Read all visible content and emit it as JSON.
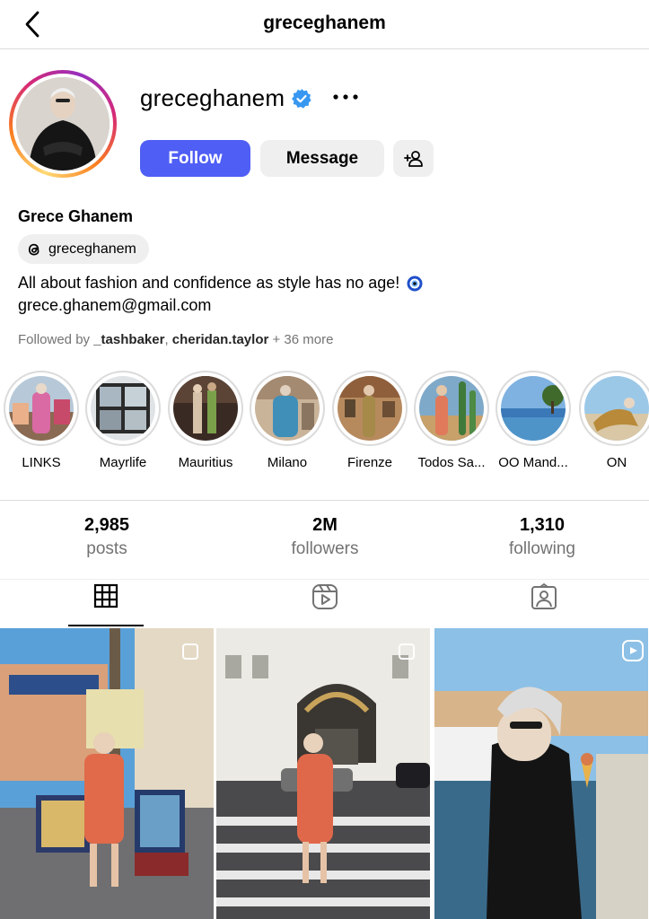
{
  "header": {
    "title": "greceghanem"
  },
  "profile": {
    "username": "greceghanem",
    "full_name": "Grece Ghanem",
    "threads_handle": "greceghanem",
    "bio_line1": "All about fashion and confidence as style has no age!",
    "email": "grece.ghanem@gmail.com",
    "followed_by_prefix": "Followed by ",
    "followed_by_user1": "_tashbaker",
    "followed_by_sep": ", ",
    "followed_by_user2": "cheridan.taylor",
    "followed_by_suffix": " + 36 more"
  },
  "actions": {
    "follow": "Follow",
    "message": "Message"
  },
  "highlights": [
    {
      "label": "LINKS"
    },
    {
      "label": "Mayrlife"
    },
    {
      "label": "Mauritius"
    },
    {
      "label": "Milano"
    },
    {
      "label": "Firenze"
    },
    {
      "label": "Todos Sa..."
    },
    {
      "label": "OO Mand..."
    },
    {
      "label": "ON"
    }
  ],
  "stats": {
    "posts": {
      "value": "2,985",
      "label": "posts"
    },
    "followers": {
      "value": "2M",
      "label": "followers"
    },
    "following": {
      "value": "1,310",
      "label": "following"
    }
  },
  "tabs": [
    {
      "icon": "grid-icon",
      "active": true
    },
    {
      "icon": "reels-icon",
      "active": false
    },
    {
      "icon": "tagged-icon",
      "active": false
    }
  ],
  "colors": {
    "follow_button": "#4f5ef5",
    "secondary_button": "#efefef",
    "verified": "#3897f0",
    "muted_text": "#737373"
  }
}
